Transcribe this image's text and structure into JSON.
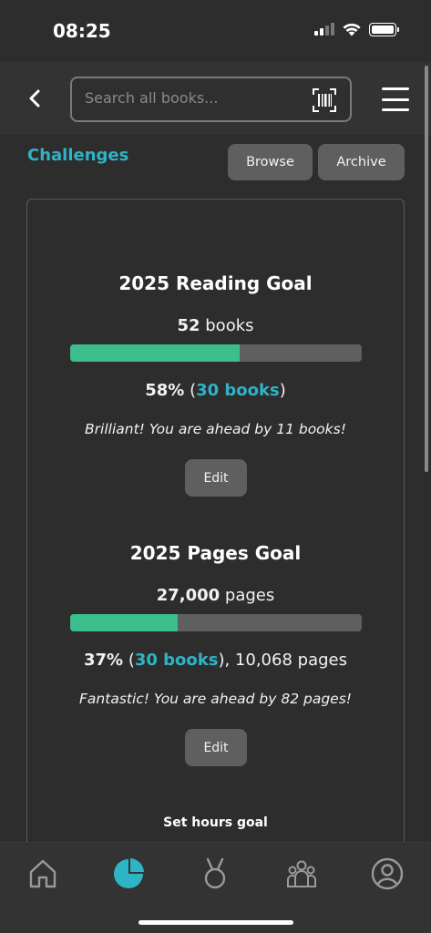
{
  "status_bar": {
    "time": "08:25"
  },
  "header": {
    "search_placeholder": "Search all books...",
    "icons": {
      "back": "chevron-left-icon",
      "barcode": "barcode-scan-icon",
      "menu": "hamburger-menu-icon"
    }
  },
  "challenges": {
    "title": "Challenges",
    "browse_label": "Browse",
    "archive_label": "Archive"
  },
  "reading_goal": {
    "title": "2025 Reading Goal",
    "target_number": "52",
    "target_unit": " books",
    "progress_fraction": 0.58,
    "percent_text": "58%",
    "open_paren": " (",
    "books_link": "30 books",
    "close_paren": ")",
    "message": "Brilliant! You are ahead by 11 books!",
    "edit_label": "Edit"
  },
  "pages_goal": {
    "title": "2025 Pages Goal",
    "target_number": "27,000",
    "target_unit": " pages",
    "progress_fraction": 0.37,
    "percent_text": "37%",
    "open_paren": " (",
    "books_link": "30 books",
    "close_paren_suffix": "), 10,068 pages",
    "message": "Fantastic! You are ahead by 82 pages!",
    "edit_label": "Edit"
  },
  "hours_goal": {
    "label": "Set hours goal"
  },
  "tab_bar": {
    "tabs": [
      "home-icon",
      "stats-pie-icon",
      "medal-icon",
      "community-icon",
      "profile-icon"
    ],
    "active_color": "#2fb3c6",
    "inactive_color": "#9a9a9a"
  },
  "colors": {
    "accent": "#2fb3c6",
    "progress": "#3bbd8c",
    "track": "#5f5f5f"
  }
}
